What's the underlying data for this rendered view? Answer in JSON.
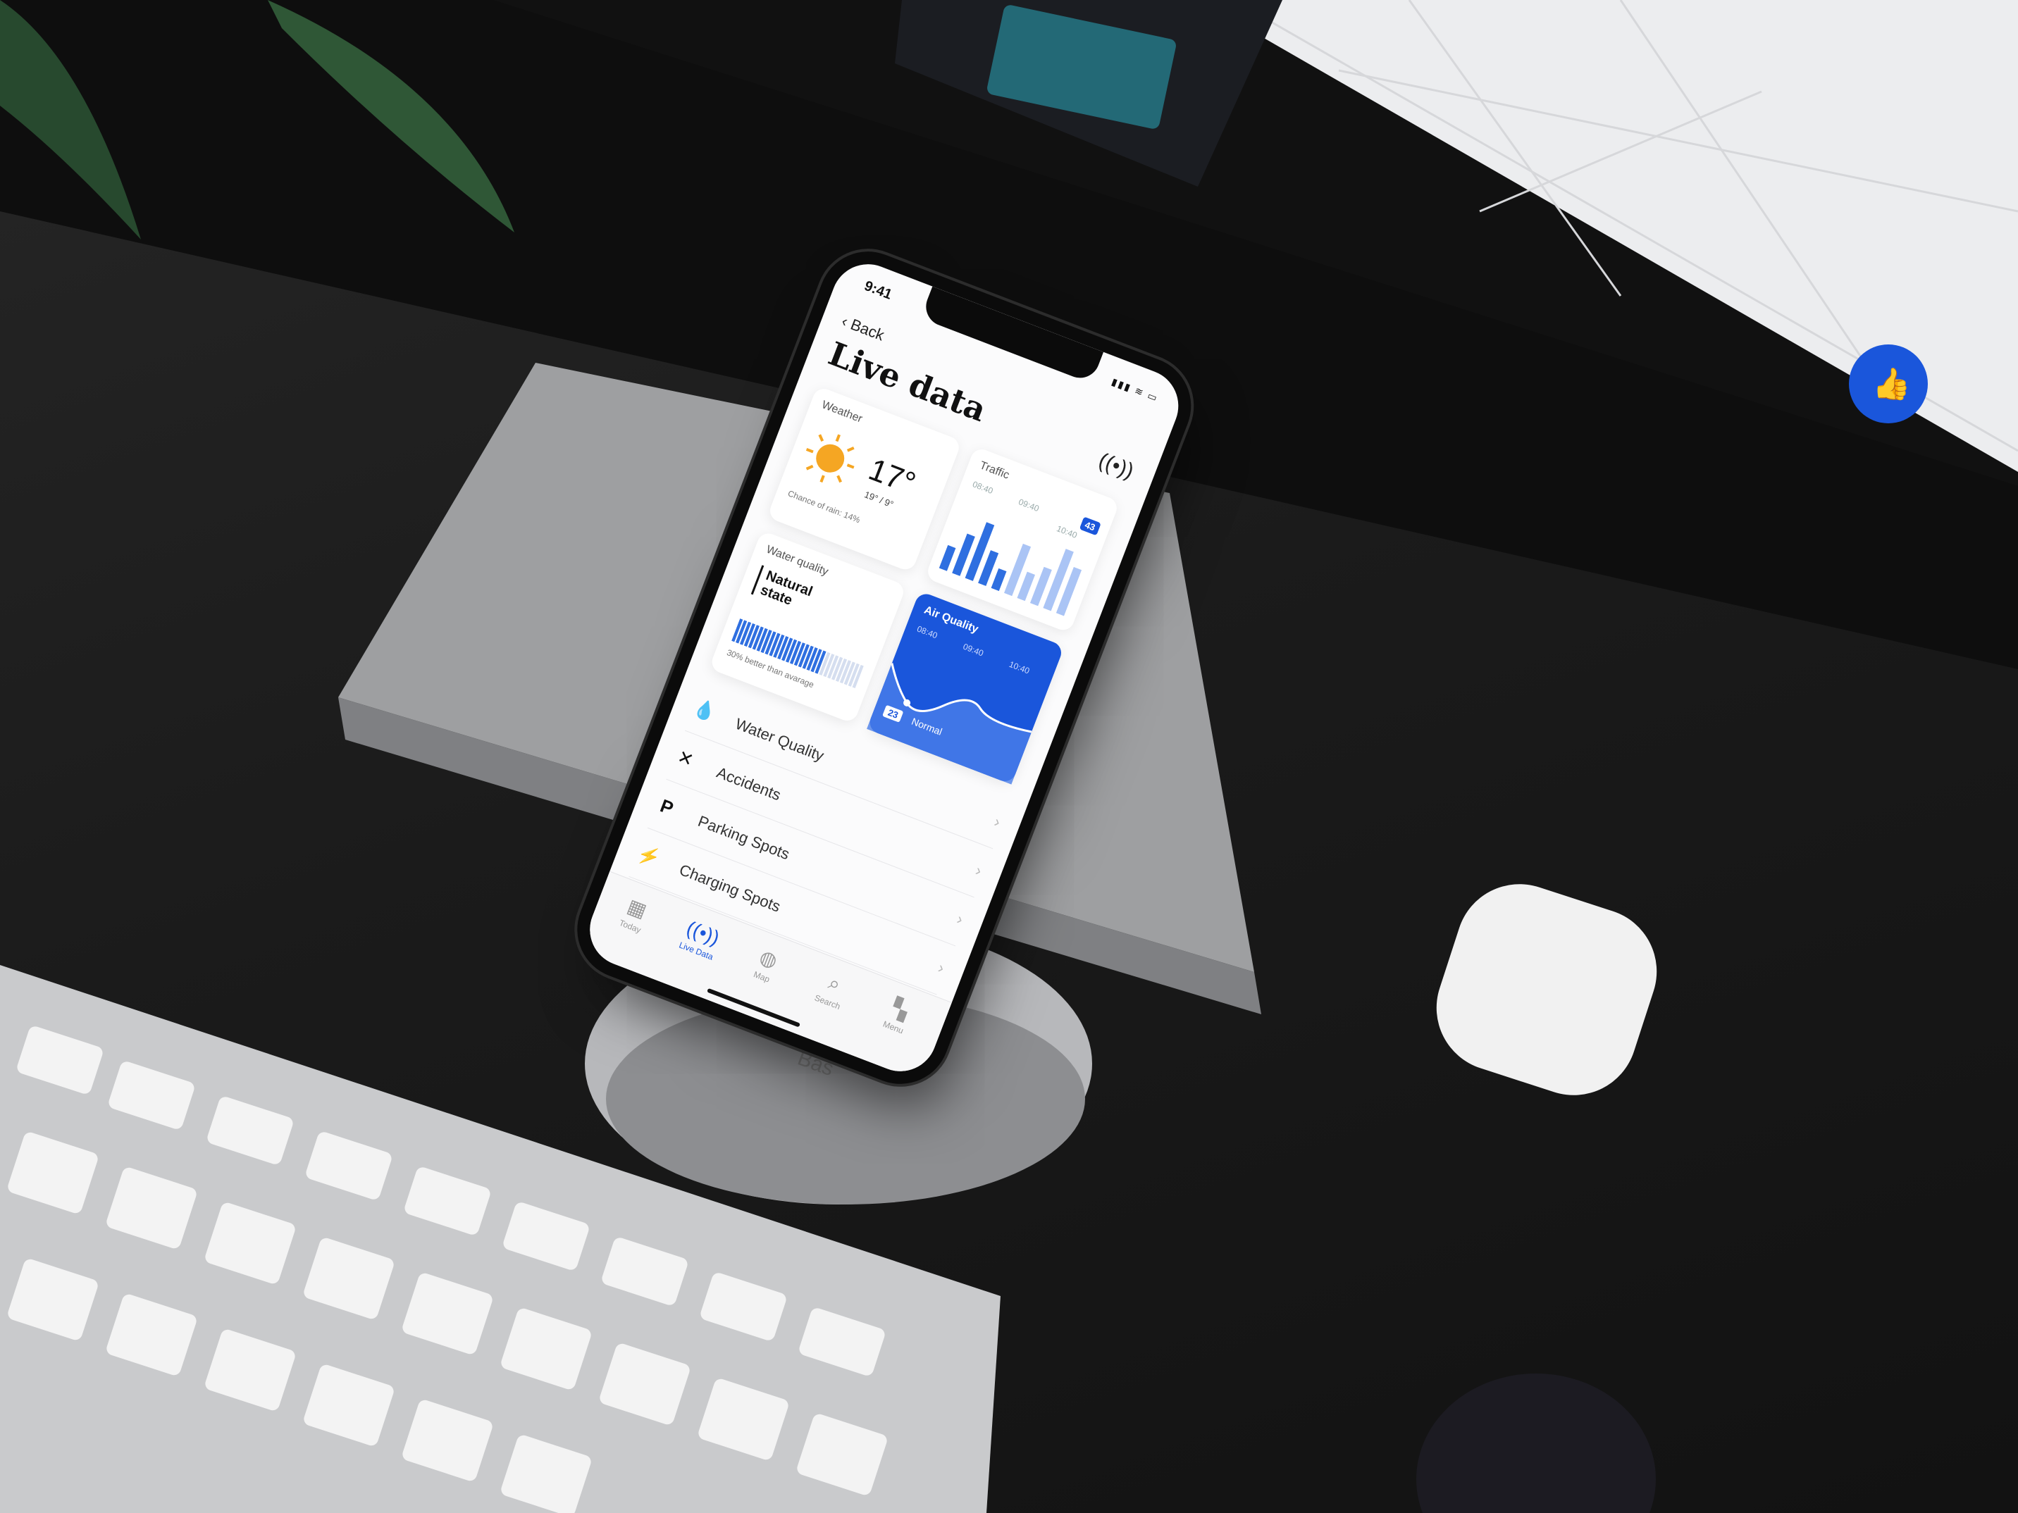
{
  "status": {
    "time": "9:41",
    "icons": "▮▮▮ ≋ ▭"
  },
  "nav": {
    "back_label": "Back",
    "title": "Live data"
  },
  "weather": {
    "label": "Weather",
    "temp": "17°",
    "range": "19° / 9°",
    "rain": "Chance of rain: 14%"
  },
  "traffic": {
    "label": "Traffic",
    "badge": "43",
    "times": [
      "08:40",
      "09:40",
      "10:40"
    ],
    "bars": [
      0.35,
      0.6,
      0.85,
      0.5,
      0.3,
      0.75,
      0.4,
      0.55,
      0.9,
      0.7
    ]
  },
  "water": {
    "label": "Water quality",
    "state": "Natural state",
    "note": "30% better than avarage",
    "level": 0.7
  },
  "air": {
    "label": "Air Quality",
    "times": [
      "08:40",
      "09:40",
      "10:40"
    ],
    "value": "23",
    "status": "Normal"
  },
  "list": [
    {
      "label": "Water Quality",
      "icon": "drops-icon"
    },
    {
      "label": "Accidents",
      "icon": "cross-icon"
    },
    {
      "label": "Parking Spots",
      "icon": "parking-icon"
    },
    {
      "label": "Charging Spots",
      "icon": "charging-icon"
    }
  ],
  "tabs": [
    {
      "label": "Today",
      "icon": "calendar-icon"
    },
    {
      "label": "Live Data",
      "icon": "broadcast-icon"
    },
    {
      "label": "Map",
      "icon": "globe-icon"
    },
    {
      "label": "Search",
      "icon": "search-icon"
    },
    {
      "label": "Menu",
      "icon": "grid-icon"
    }
  ],
  "colors": {
    "accent": "#1a56db",
    "sun": "#f5a623",
    "bar": "#2f6fe0"
  }
}
